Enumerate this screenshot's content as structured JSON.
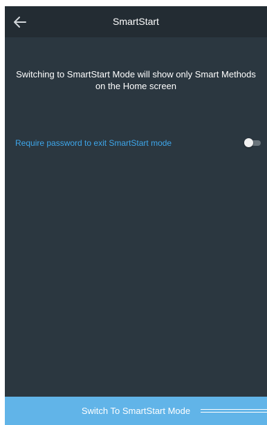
{
  "header": {
    "title": "SmartStart",
    "back_icon": "arrow-left-icon"
  },
  "info_text": "Switching to SmartStart Mode will show only Smart Methods on the Home screen",
  "option": {
    "label": "Require password to exit SmartStart mode",
    "toggle_state": "off"
  },
  "action": {
    "label": "Switch To SmartStart Mode"
  },
  "colors": {
    "header_bg": "#232c33",
    "screen_bg": "#2b3740",
    "accent_text": "#3ea6ea",
    "action_bar": "#61b4e8"
  }
}
